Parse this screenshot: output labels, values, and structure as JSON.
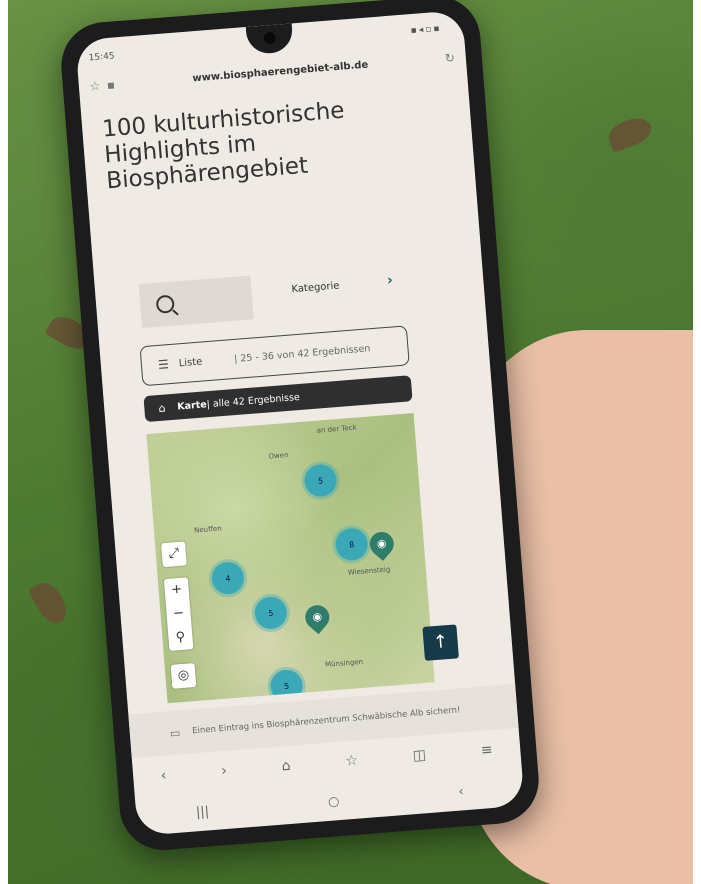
{
  "status": {
    "time": "15:45",
    "icons": "▪◂▫▪"
  },
  "browser": {
    "url": "www.biosphaerengebiet-alb.de",
    "star_icon": "star-icon",
    "tabs_icon": "tabs-icon",
    "reload_icon": "reload-icon"
  },
  "page": {
    "title": "100 kulturhistorische Highlights im Biosphärengebiet",
    "kategorie": "Kategorie",
    "liste_label": "Liste",
    "liste_count": "| 25 - 36 von 42 Ergebnissen",
    "karte_strong": "Karte",
    "karte_rest": " | alle 42 Ergebnisse"
  },
  "map": {
    "labels": [
      "an der Teck",
      "Owen",
      "Neuffen",
      "Wiesensteig",
      "Münsingen"
    ],
    "clusters": [
      "5",
      "8",
      "4",
      "5",
      "5"
    ],
    "controls": [
      "⤢",
      "+",
      "−",
      "⚲",
      "◎"
    ]
  },
  "banner": {
    "text": "Einen Eintrag ins Biosphärenzentrum Schwäbische Alb sichern!"
  },
  "browsernav": [
    "‹",
    "›",
    "⌂",
    "☆",
    "◫",
    "≡"
  ],
  "sysnav": [
    "|||",
    "○",
    "‹"
  ],
  "colors": {
    "accent": "#3aa8b7",
    "dark": "#2f2f2f",
    "pin": "#2e7d6a"
  }
}
